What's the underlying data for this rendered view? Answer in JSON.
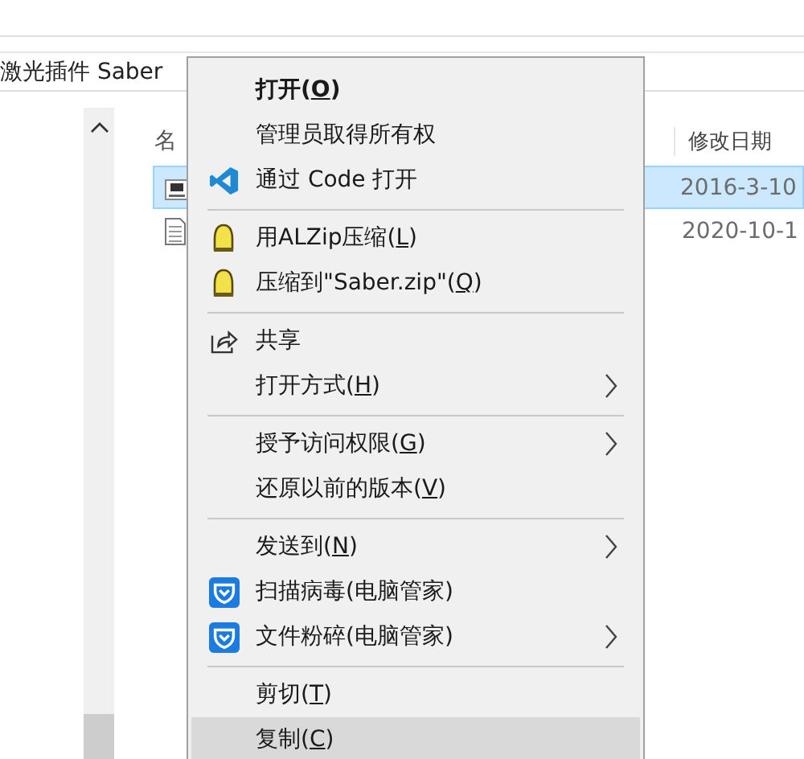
{
  "breadcrumb": "激光插件 Saber",
  "columns": [
    {
      "label": "名"
    },
    {
      "label": "修改日期"
    }
  ],
  "files": [
    {
      "kind": "archive",
      "date": "2016-3-10",
      "selected": true
    },
    {
      "kind": "text",
      "date": "2020-10-1",
      "selected": false
    }
  ],
  "menu": [
    {
      "kind": "item",
      "label": "打开(",
      "access_key": "O",
      "label_end": ")",
      "bold": true,
      "submenu": false,
      "selected": false
    },
    {
      "kind": "item",
      "label": "管理员取得所有权",
      "bold": false,
      "submenu": false,
      "selected": false
    },
    {
      "kind": "code_item",
      "label": "通过 Code 打开",
      "bold": false,
      "submenu": false,
      "selected": false
    },
    {
      "kind": "separator"
    },
    {
      "kind": "zip_item",
      "label": "用ALZip压缩(",
      "access_key": "L",
      "label_end": ")",
      "bold": false,
      "submenu": false,
      "selected": false
    },
    {
      "kind": "zip_item",
      "label": "压缩到\"Saber.zip\"(",
      "access_key": "Q",
      "label_end": ")",
      "bold": false,
      "submenu": false,
      "selected": false
    },
    {
      "kind": "separator"
    },
    {
      "kind": "share_item",
      "label": "共享",
      "bold": false,
      "submenu": false,
      "selected": false
    },
    {
      "kind": "item",
      "label": "打开方式(",
      "access_key": "H",
      "label_end": ")",
      "bold": false,
      "submenu": true,
      "selected": false
    },
    {
      "kind": "separator"
    },
    {
      "kind": "item",
      "label": "授予访问权限(",
      "access_key": "G",
      "label_end": ")",
      "bold": false,
      "submenu": true,
      "selected": false
    },
    {
      "kind": "item",
      "label": "还原以前的版本(",
      "access_key": "V",
      "label_end": ")",
      "bold": false,
      "submenu": false,
      "selected": false
    },
    {
      "kind": "separator"
    },
    {
      "kind": "item",
      "label": "发送到(",
      "access_key": "N",
      "label_end": ")",
      "bold": false,
      "submenu": true,
      "selected": false
    },
    {
      "kind": "shield_item",
      "label": "扫描病毒(电脑管家)",
      "bold": false,
      "submenu": false,
      "selected": false
    },
    {
      "kind": "shield_item",
      "label": "文件粉碎(电脑管家)",
      "bold": false,
      "submenu": true,
      "selected": false
    },
    {
      "kind": "separator"
    },
    {
      "kind": "item",
      "label": "剪切(",
      "access_key": "T",
      "label_end": ")",
      "bold": false,
      "submenu": false,
      "selected": false
    },
    {
      "kind": "item",
      "label": "复制(",
      "access_key": "C",
      "label_end": ")",
      "bold": false,
      "submenu": false,
      "selected": true
    }
  ]
}
